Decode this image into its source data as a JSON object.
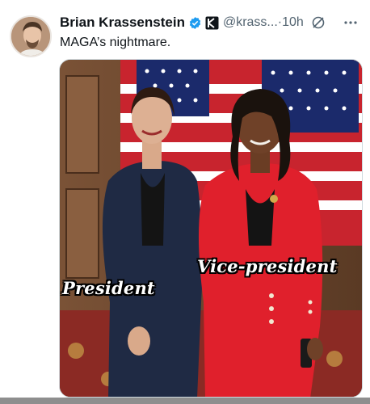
{
  "author": {
    "display_name": "Brian Krassenstein",
    "handle": "@krass...",
    "separator": "·",
    "time": "10h",
    "verified_icon": "verified-badge-icon",
    "affiliation_icon": "affiliate-k-icon"
  },
  "tweet": {
    "text": "MAGA’s nightmare."
  },
  "media": {
    "caption_left": "President",
    "caption_right": "Vice-president"
  },
  "colors": {
    "verified": "#1d9bf0",
    "handle": "#536471",
    "text": "#0f1419",
    "suit_red": "#e0202c",
    "suit_navy": "#1f2a44"
  }
}
